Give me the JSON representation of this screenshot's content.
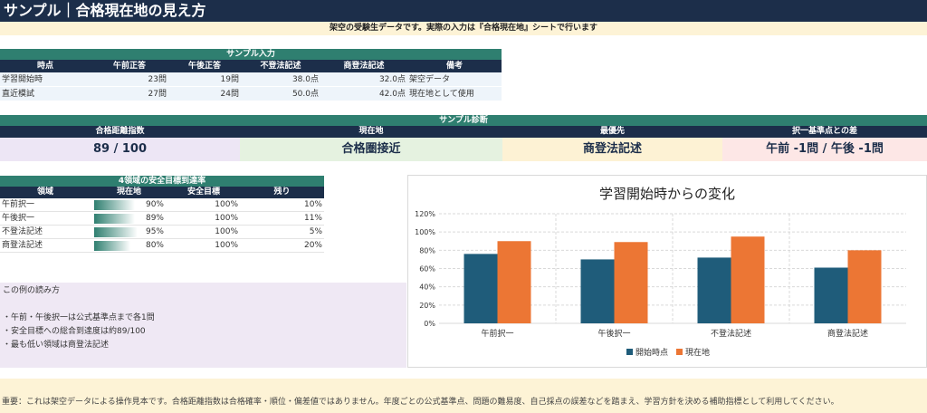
{
  "title": "サンプル｜合格現在地の見え方",
  "notice": "架空の受験生データです。実際の入力は『合格現在地』シートで行います",
  "sample_input": {
    "section_title": "サンプル入力",
    "headers": [
      "時点",
      "午前正答",
      "午後正答",
      "不登法記述",
      "商登法記述",
      "備考"
    ],
    "rows": [
      [
        "学習開始時",
        "23問",
        "19問",
        "38.0点",
        "32.0点",
        "架空データ"
      ],
      [
        "直近模試",
        "27問",
        "24問",
        "50.0点",
        "42.0点",
        "現在地として使用"
      ]
    ]
  },
  "diagnosis": {
    "section_title": "サンプル診断",
    "headers": [
      "合格距離指数",
      "現在地",
      "最優先",
      "択一基準点との差"
    ],
    "values": [
      "89 / 100",
      "合格圏接近",
      "商登法記述",
      "午前 -1問 / 午後 -1問"
    ],
    "colors": [
      "#ede6f5",
      "#e5f2e0",
      "#fdf2d4",
      "#fde7e6"
    ]
  },
  "areas": {
    "section_title": "4領域の安全目標到達率",
    "headers": [
      "領域",
      "現在地",
      "安全目標",
      "残り"
    ],
    "rows": [
      {
        "name": "午前択一",
        "current": "90%",
        "target": "100%",
        "remain": "10%",
        "fill": 0.9
      },
      {
        "name": "午後択一",
        "current": "89%",
        "target": "100%",
        "remain": "11%",
        "fill": 0.89
      },
      {
        "name": "不登法記述",
        "current": "95%",
        "target": "100%",
        "remain": "5%",
        "fill": 0.95
      },
      {
        "name": "商登法記述",
        "current": "80%",
        "target": "100%",
        "remain": "20%",
        "fill": 0.8
      }
    ]
  },
  "reading": {
    "title": "この例の読み方",
    "lines": [
      "・午前・午後択一は公式基準点まで各1問",
      "・安全目標への総合到達度は約89/100",
      "・最も低い領域は商登法記述"
    ]
  },
  "chart_data": {
    "type": "bar",
    "title": "学習開始時からの変化",
    "categories": [
      "午前択一",
      "午後択一",
      "不登法記述",
      "商登法記述"
    ],
    "series": [
      {
        "name": "開始時点",
        "values": [
          76,
          70,
          72,
          61
        ],
        "color": "#1f5c7a"
      },
      {
        "name": "現在地",
        "values": [
          90,
          89,
          95,
          80
        ],
        "color": "#ec7634"
      }
    ],
    "ylim": [
      0,
      120
    ],
    "yticks": [
      "0%",
      "20%",
      "40%",
      "60%",
      "80%",
      "100%",
      "120%"
    ],
    "legend": "bottom",
    "grid": true
  },
  "footer": "重要：これは架空データによる操作見本です。合格距離指数は合格確率・順位・偏差値ではありません。年度ごとの公式基準点、問題の難易度、自己採点の誤差などを踏まえ、学習方針を決める補助指標として利用してください。"
}
